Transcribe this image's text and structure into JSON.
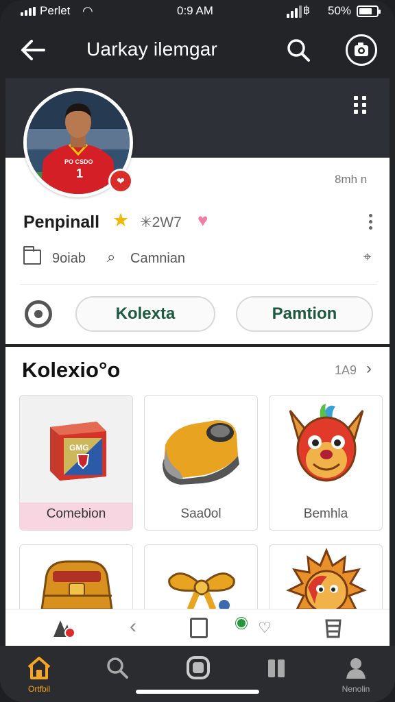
{
  "status_bar": {
    "carrier": "Perlet",
    "time": "0:9 AM",
    "battery": "50%"
  },
  "header": {
    "title": "Uarkay ilemgar"
  },
  "profile": {
    "meta_right": "8mh n",
    "name": "Penpinall",
    "code": "2W7",
    "info_a": "9oiab",
    "info_b": "Camnian",
    "button_1": "Kolexta",
    "button_2": "Pamtion",
    "jersey_text": "PO CSDO"
  },
  "collection": {
    "title": "Kolexio°o",
    "more": "1A9",
    "items": [
      {
        "label": "Comebion",
        "box_text": "GMG"
      },
      {
        "label": "Saa0ol"
      },
      {
        "label": "Bemhla"
      },
      {
        "label": ""
      },
      {
        "label": ""
      },
      {
        "label": ""
      }
    ]
  },
  "tabs": {
    "home": "Ortfbil",
    "profile": "Nenolin"
  },
  "colors": {
    "accent": "#f6a623",
    "pill_text": "#1f5a3e",
    "badge": "#d92d2a"
  }
}
